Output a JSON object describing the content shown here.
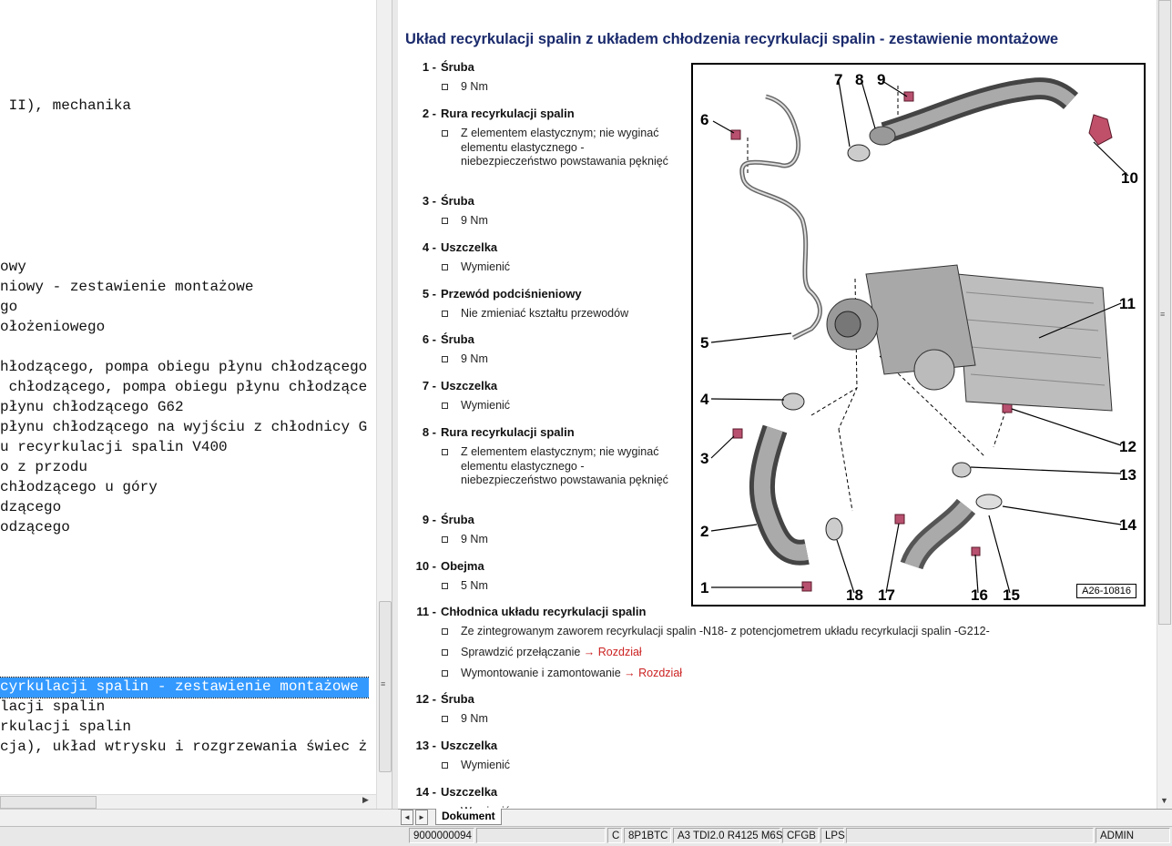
{
  "tree_lines": [
    {
      "text": " II), mechanika",
      "selected": false
    },
    {
      "text": "owy",
      "selected": false
    },
    {
      "text": "niowy - zestawienie montażowe",
      "selected": false
    },
    {
      "text": "go",
      "selected": false
    },
    {
      "text": "ołożeniowego",
      "selected": false
    },
    {
      "text": "hłodzącego, pompa obiegu płynu chłodzącego",
      "selected": false
    },
    {
      "text": " chłodzącego, pompa obiegu płynu chłodzące",
      "selected": false
    },
    {
      "text": "płynu chłodzącego G62",
      "selected": false
    },
    {
      "text": "płynu chłodzącego na wyjściu z chłodnicy G",
      "selected": false
    },
    {
      "text": "u recyrkulacji spalin V400",
      "selected": false
    },
    {
      "text": "o z przodu",
      "selected": false
    },
    {
      "text": "chłodzącego u góry",
      "selected": false
    },
    {
      "text": "dzącego",
      "selected": false
    },
    {
      "text": "odzącego",
      "selected": false
    },
    {
      "text": "cyrkulacji spalin - zestawienie montażowe",
      "selected": true
    },
    {
      "text": "lacji spalin",
      "selected": false
    },
    {
      "text": "rkulacji spalin",
      "selected": false
    },
    {
      "text": "cja), układ wtrysku i rozgrzewania świec ż",
      "selected": false
    }
  ],
  "document": {
    "title": "Układ recyrkulacji spalin z układem chłodzenia recyrkulacji spalin - zestawienie montażowe",
    "items": [
      {
        "num": "1 -",
        "name": "Śruba",
        "notes": [
          "9 Nm"
        ]
      },
      {
        "num": "2 -",
        "name": "Rura recyrkulacji spalin",
        "notes": [
          "Z elementem elastycznym; nie wyginać elementu elastycznego - niebezpieczeństwo powstawania pęknięć"
        ]
      },
      {
        "num": "3 -",
        "name": "Śruba",
        "notes": [
          "9 Nm"
        ]
      },
      {
        "num": "4 -",
        "name": "Uszczelka",
        "notes": [
          "Wymienić"
        ]
      },
      {
        "num": "5 -",
        "name": "Przewód podciśnieniowy",
        "notes": [
          "Nie zmieniać kształtu przewodów"
        ]
      },
      {
        "num": "6 -",
        "name": "Śruba",
        "notes": [
          "9 Nm"
        ]
      },
      {
        "num": "7 -",
        "name": "Uszczelka",
        "notes": [
          "Wymienić"
        ]
      },
      {
        "num": "8 -",
        "name": "Rura recyrkulacji spalin",
        "notes": [
          "Z elementem elastycznym; nie wyginać elementu elastycznego - niebezpieczeństwo powstawania pęknięć"
        ]
      },
      {
        "num": "9 -",
        "name": "Śruba",
        "notes": [
          "9 Nm"
        ]
      },
      {
        "num": "10 -",
        "name": "Obejma",
        "notes": [
          "5 Nm"
        ]
      },
      {
        "num": "11 -",
        "name": "Chłodnica układu recyrkulacji spalin",
        "notes": [
          "Ze zintegrowanym zaworem recyrkulacji spalin -N18- z potencjometrem układu recyrkulacji spalin -G212-"
        ],
        "links": [
          {
            "text": "Sprawdzić przełączanie",
            "link": "→ Rozdział"
          },
          {
            "text": "Wymontowanie i zamontowanie",
            "link": "→ Rozdział"
          }
        ]
      },
      {
        "num": "12 -",
        "name": "Śruba",
        "notes": [
          "9 Nm"
        ]
      },
      {
        "num": "13 -",
        "name": "Uszczelka",
        "notes": [
          "Wymienić"
        ]
      },
      {
        "num": "14 -",
        "name": "Uszczelka",
        "notes": [
          "Wymienić"
        ]
      }
    ],
    "figure_code": "A26-10816",
    "figure_labels": [
      "1",
      "2",
      "3",
      "4",
      "5",
      "6",
      "7",
      "8",
      "9",
      "10",
      "11",
      "12",
      "13",
      "14",
      "15",
      "16",
      "17",
      "18"
    ]
  },
  "tabs": {
    "nav_left": "◄",
    "nav_right": "►",
    "active": "Dokument"
  },
  "status_bar": {
    "id": "9000000094",
    "c": "C",
    "code": "8P1BTC",
    "model": "A3 TDI2.0 R4125 M6S",
    "cfgb": "CFGB",
    "lps": "LPS",
    "user": "ADMIN"
  },
  "colors": {
    "title": "#1a2a6c",
    "link": "#cc2222",
    "selection": "#3399ff"
  }
}
